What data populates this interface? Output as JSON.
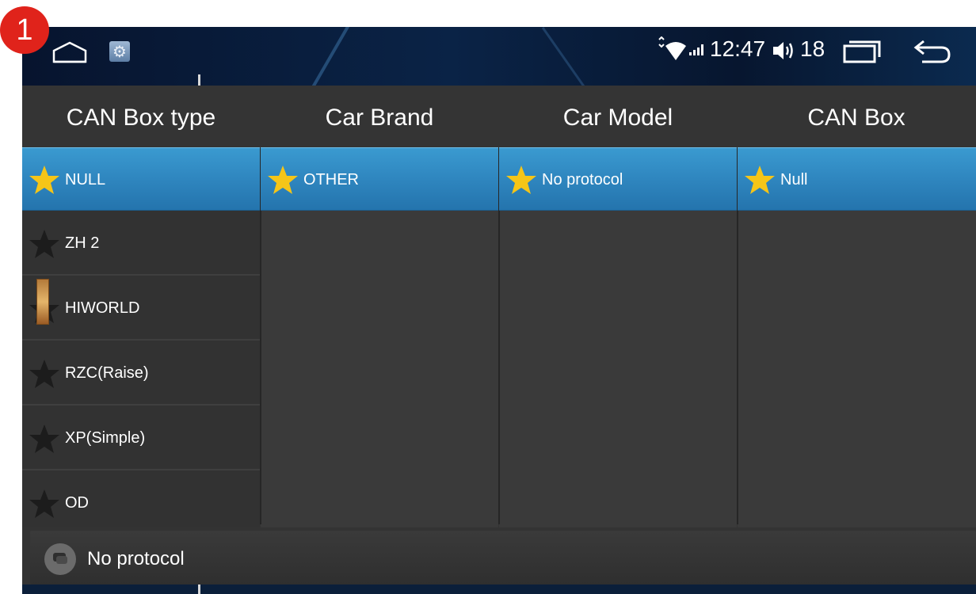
{
  "badge": {
    "number": "1"
  },
  "status_bar": {
    "time": "12:47",
    "volume": "18",
    "icons": [
      "home-icon",
      "settings-icon",
      "wifi-icon",
      "signal-icon",
      "volume-icon",
      "recent-apps-icon",
      "back-icon"
    ]
  },
  "columns": [
    {
      "header": "CAN Box type",
      "items": [
        {
          "label": "NULL",
          "selected": true
        },
        {
          "label": "ZH 2",
          "selected": false
        },
        {
          "label": "HIWORLD",
          "selected": false
        },
        {
          "label": "RZC(Raise)",
          "selected": false
        },
        {
          "label": "XP(Simple)",
          "selected": false
        },
        {
          "label": "OD",
          "selected": false
        }
      ]
    },
    {
      "header": "Car Brand",
      "items": [
        {
          "label": "OTHER",
          "selected": true
        }
      ]
    },
    {
      "header": "Car Model",
      "items": [
        {
          "label": "No protocol",
          "selected": true
        }
      ]
    },
    {
      "header": "CAN Box",
      "items": [
        {
          "label": "Null",
          "selected": true
        }
      ]
    }
  ],
  "footer": {
    "message": "No protocol"
  },
  "colors": {
    "selected_row": "#2f86bf",
    "star_active": "#f5c518",
    "star_inactive": "#1c1c1c",
    "badge": "#e0231b"
  }
}
